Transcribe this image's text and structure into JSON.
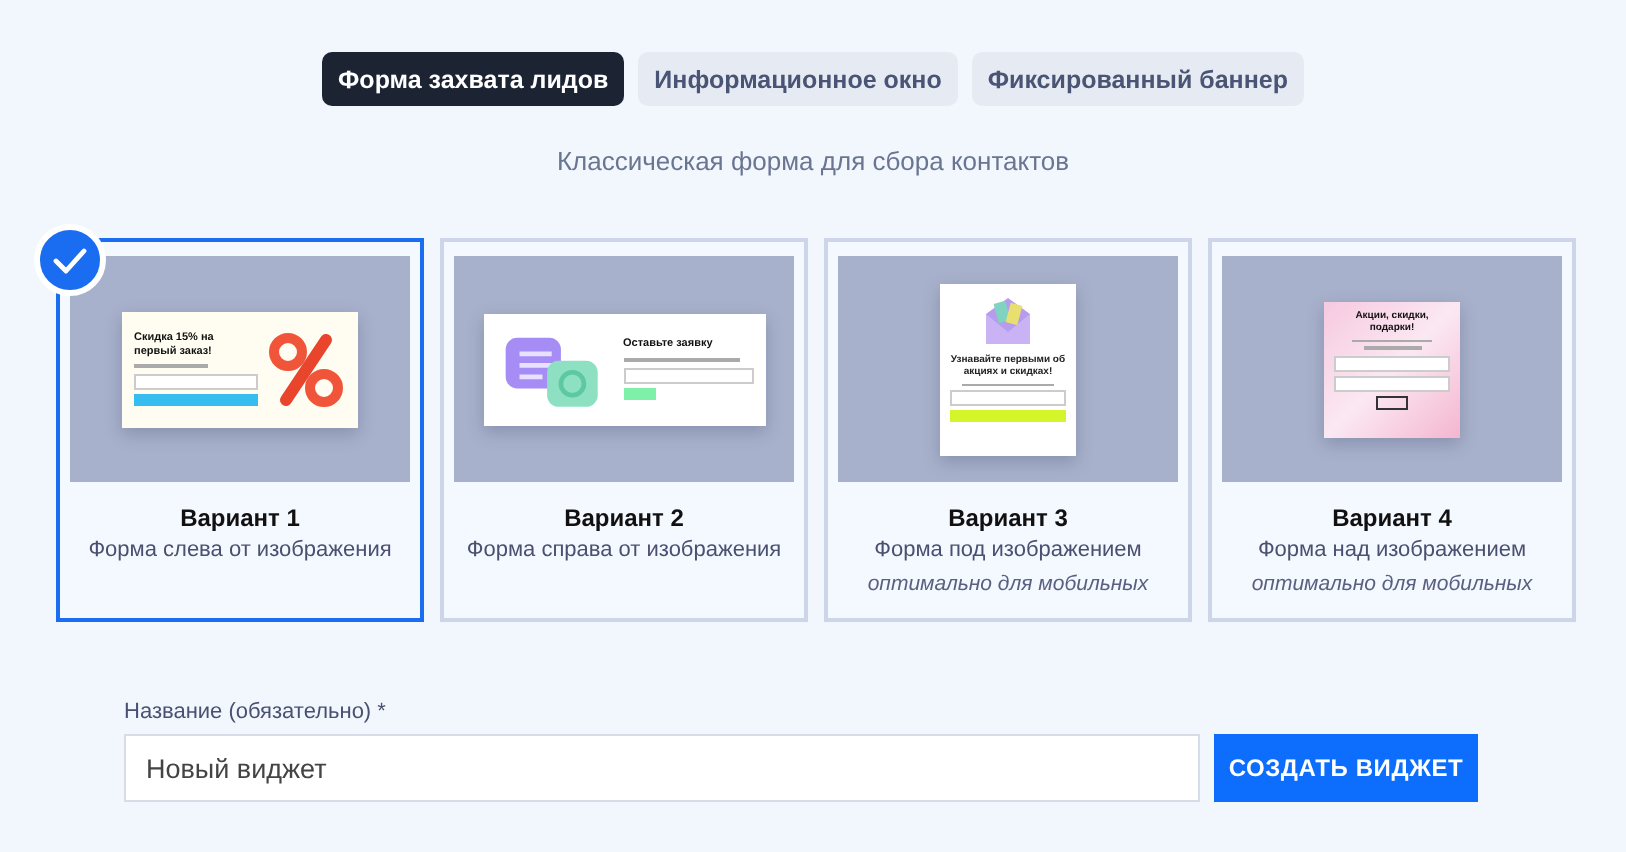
{
  "tabs": [
    {
      "label": "Форма захвата лидов",
      "selected": true
    },
    {
      "label": "Информационное окно",
      "selected": false
    },
    {
      "label": "Фиксированный баннер",
      "selected": false
    }
  ],
  "description": "Классическая форма для сбора контактов",
  "variants": [
    {
      "title": "Вариант 1",
      "subtitle": "Форма слева от изображения",
      "selected": true,
      "preview": {
        "kind": "image-right",
        "headline": "Скидка 15% на первый заказ!"
      }
    },
    {
      "title": "Вариант 2",
      "subtitle": "Форма справа от изображения",
      "selected": false,
      "preview": {
        "kind": "image-left",
        "headline": "Оставьте заявку"
      }
    },
    {
      "title": "Вариант 3",
      "subtitle": "Форма под изображением",
      "note": "оптимально для мобильных",
      "selected": false,
      "preview": {
        "kind": "image-top",
        "headline": "Узнавайте первыми об акциях и скидках!"
      }
    },
    {
      "title": "Вариант 4",
      "subtitle": "Форма над изображением",
      "note": "оптимально для мобильных",
      "selected": false,
      "preview": {
        "kind": "image-bg",
        "headline": "Акции, скидки, подарки!"
      }
    }
  ],
  "name_field": {
    "label": "Название (обязательно) *",
    "placeholder": "Новый виджет"
  },
  "create_button": "СОЗДАТЬ ВИДЖЕТ"
}
